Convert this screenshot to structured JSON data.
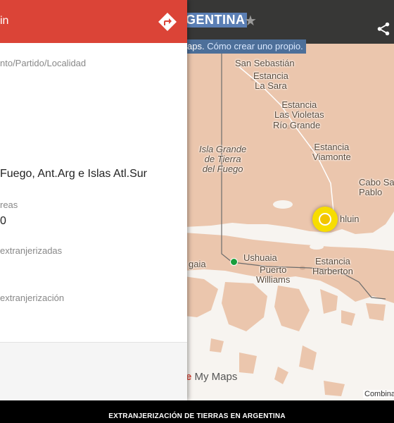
{
  "map": {
    "title": "GENTINA",
    "info_text": "aps.",
    "info_link": "Cómo crear uno propio.",
    "places": {
      "san_sebastian": "San Sebastián",
      "estancia_la_sara": "Estancia\nLa Sara",
      "estancia_las_violetas": "Estancia\nLas Violetas",
      "rio_grande": "Río Grande",
      "isla_grande": "Isla Grande\nde Tierra\ndel Fuego",
      "estancia_viamonte": "Estancia\nViamonte",
      "cabo_san_pablo": "Cabo Sa\nPablo",
      "ushuaia_fragment": "hluin",
      "ushuaia": "Ushuaia",
      "estancia_harberton": "Estancia\nHarberton",
      "puerto_williams": "Puerto\nWilliams",
      "lapataia": "gaia"
    },
    "branding": "My Maps",
    "combina": "Combina"
  },
  "panel": {
    "header_title": "in",
    "field1_label": "nto/Partido/Localidad",
    "province_value": "Fuego, Ant.Arg e Islas Atl.Sur",
    "field2_label": "reas",
    "field2_value": "0",
    "field3_label": "extranjerizadas",
    "field4_label": "extranjerización"
  },
  "footer": {
    "caption": "EXTRANJERIZACIÓN DE TIERRAS EN ARGENTINA"
  },
  "colors": {
    "panel_header": "#db4437",
    "land": "#ebc6ad",
    "marker": "#f7dd00"
  }
}
